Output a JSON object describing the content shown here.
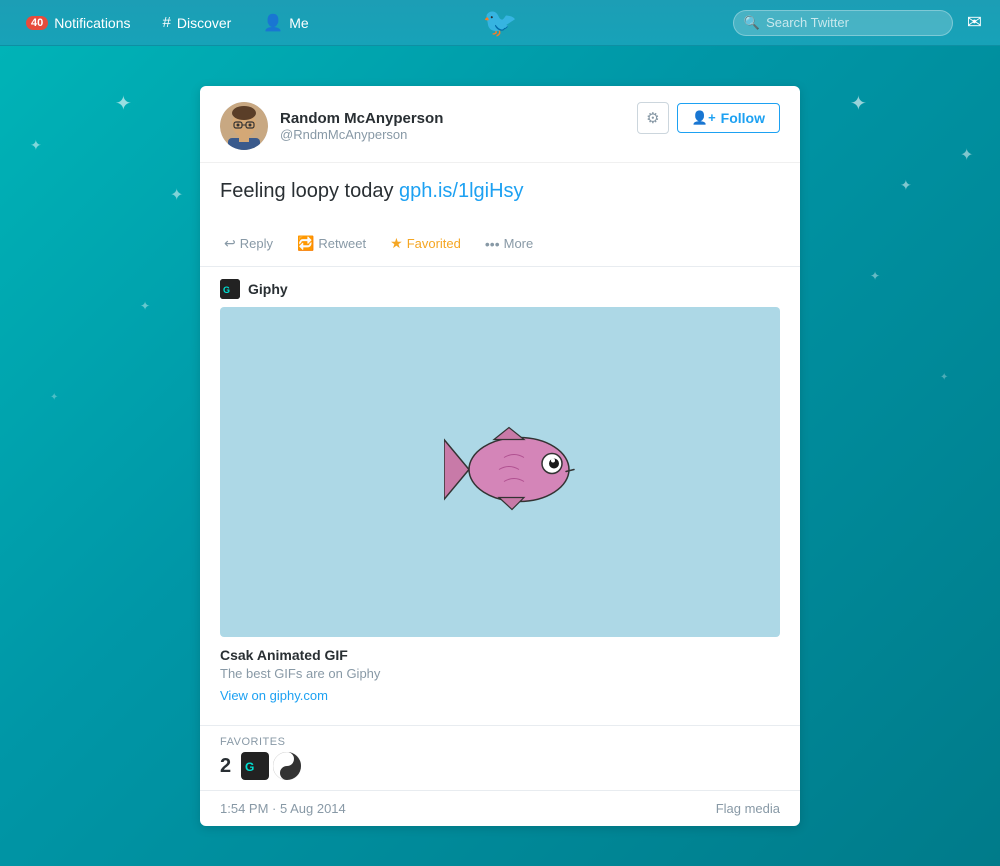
{
  "navbar": {
    "notifications_badge": "40",
    "notifications_label": "Notifications",
    "discover_label": "Discover",
    "me_label": "Me",
    "search_placeholder": "Search Twitter",
    "mail_icon": "✉"
  },
  "tweet": {
    "user": {
      "name": "Random McAnyperson",
      "handle": "@RndmMcAnyperson"
    },
    "text_before_link": "Feeling loopy today ",
    "link_text": "gph.is/1lgiHsy",
    "link_href": "http://gph.is/1lgiHsy",
    "actions": {
      "reply": "Reply",
      "retweet": "Retweet",
      "favorited": "Favorited",
      "more": "More"
    },
    "embed": {
      "source": "Giphy",
      "giphy_logo": "G",
      "card_title": "Csak Animated GIF",
      "card_desc": "The best GIFs are on Giphy",
      "card_link": "View on giphy.com"
    },
    "favorites": {
      "label": "FAVORITES",
      "count": "2"
    },
    "timestamp": "1:54 PM · 5 Aug 2014",
    "flag_media": "Flag media"
  }
}
